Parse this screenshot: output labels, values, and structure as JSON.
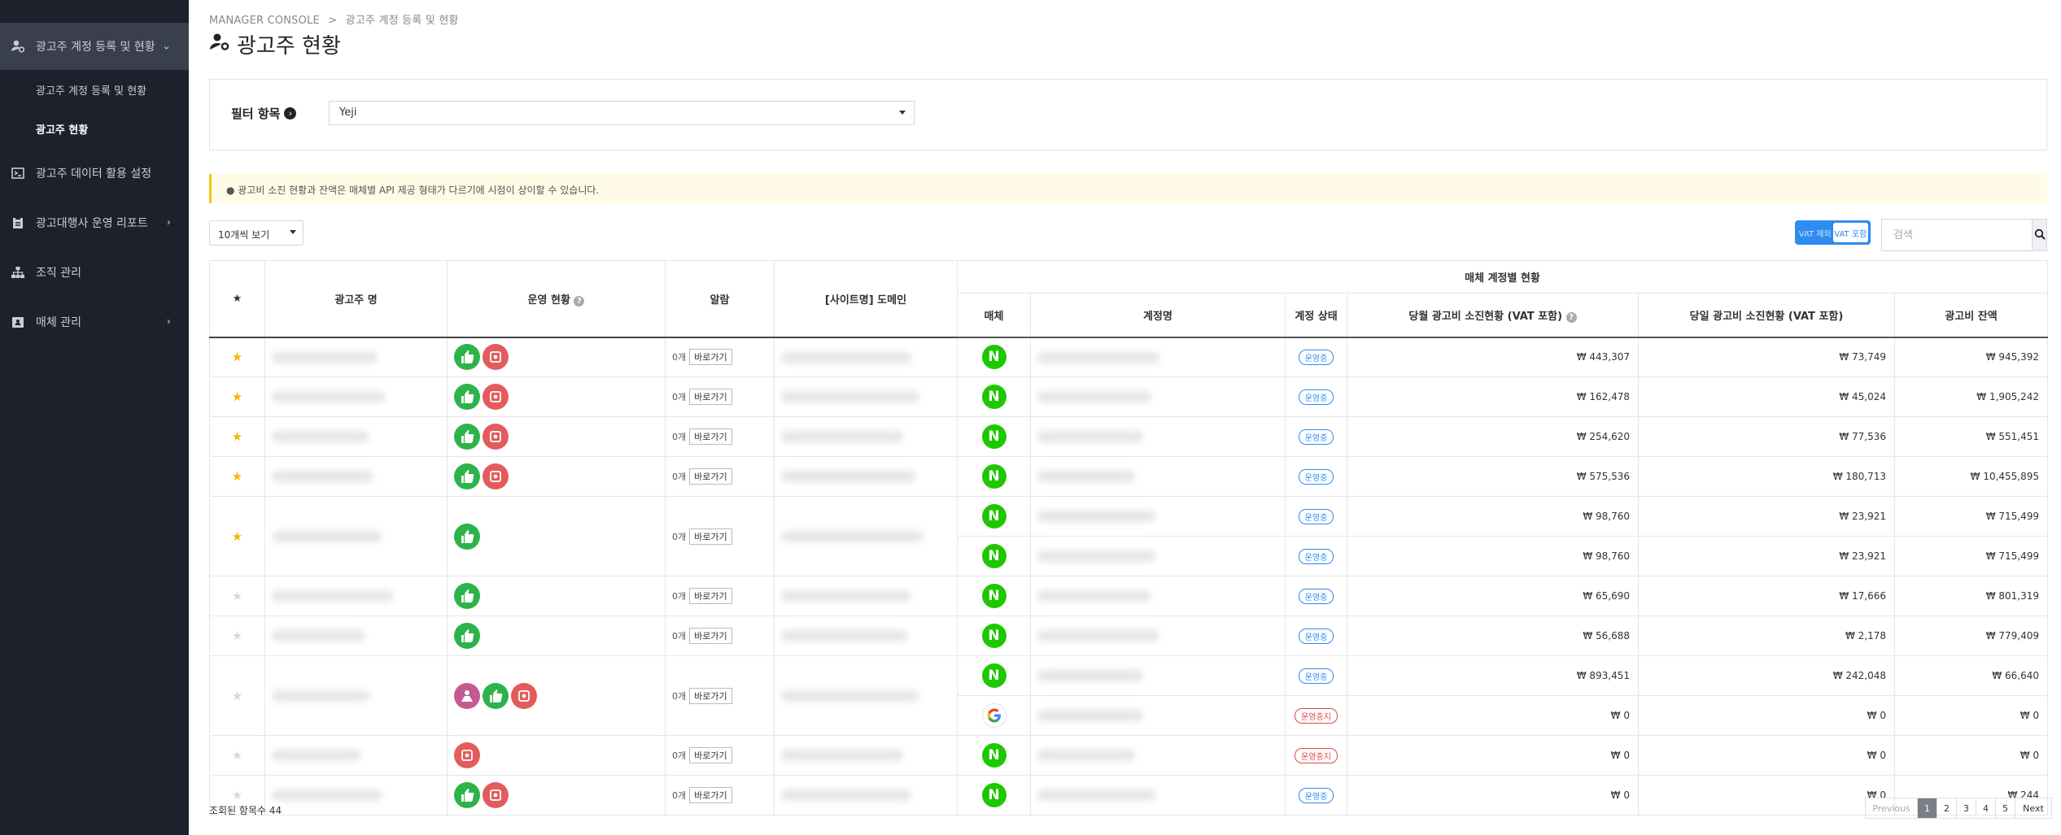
{
  "sidebar": {
    "items": [
      {
        "label": "광고주 계정 등록 및 현황"
      },
      {
        "label": "광고주 데이터 활용 설정"
      },
      {
        "label": "광고대행사 운영 리포트"
      },
      {
        "label": "조직 관리"
      },
      {
        "label": "매체 관리"
      }
    ],
    "subitems": [
      {
        "label": "광고주 계정 등록 및 현황"
      },
      {
        "label": "광고주 현황"
      }
    ]
  },
  "header": {
    "breadcrumb_root": "MANAGER CONSOLE",
    "breadcrumb_sep": ">",
    "breadcrumb_page": "광고주 계정 등록 및 현황",
    "title": "광고주 현황"
  },
  "filter": {
    "label": "필터 항목",
    "selected": "Yeji"
  },
  "notice": "● 광고비 소진 현황과 잔액은 매체별 API 제공 형태가 다르기에 시점이 상이할 수 있습니다.",
  "controls": {
    "per_page": "10개씩 보기",
    "vat_off": "VAT 제외",
    "vat_on": "VAT 포함",
    "search_placeholder": "검색"
  },
  "table": {
    "headers": {
      "star": "★",
      "advertiser": "광고주 명",
      "ops": "운영 현황",
      "alarm": "알람",
      "domain": "[사이트명] 도메인",
      "group": "매체 계정별 현황",
      "media": "매체",
      "account": "계정명",
      "status": "계정 상태",
      "month_spend": "당월 광고비 소진현황 (VAT 포함)",
      "day_spend": "당일 광고비 소진현황 (VAT 포함)",
      "balance": "광고비 잔액"
    },
    "alarm_count": "0개",
    "go_label": "바로가기",
    "status_on": "운영중",
    "status_off": "운영중지",
    "rows": [
      {
        "star": true,
        "ops": [
          "green",
          "red"
        ],
        "accounts": [
          {
            "media": "naver",
            "status": "on",
            "month": "₩ 443,307",
            "day": "₩ 73,749",
            "balance": "₩ 945,392"
          }
        ]
      },
      {
        "star": true,
        "ops": [
          "green",
          "red"
        ],
        "accounts": [
          {
            "media": "naver",
            "status": "on",
            "month": "₩ 162,478",
            "day": "₩ 45,024",
            "balance": "₩ 1,905,242"
          }
        ]
      },
      {
        "star": true,
        "ops": [
          "green",
          "red"
        ],
        "accounts": [
          {
            "media": "naver",
            "status": "on",
            "month": "₩ 254,620",
            "day": "₩ 77,536",
            "balance": "₩ 551,451"
          }
        ]
      },
      {
        "star": true,
        "ops": [
          "green",
          "red"
        ],
        "accounts": [
          {
            "media": "naver",
            "status": "on",
            "month": "₩ 575,536",
            "day": "₩ 180,713",
            "balance": "₩ 10,455,895"
          }
        ]
      },
      {
        "star": true,
        "ops": [
          "green"
        ],
        "accounts": [
          {
            "media": "naver",
            "status": "on",
            "month": "₩ 98,760",
            "day": "₩ 23,921",
            "balance": "₩ 715,499"
          },
          {
            "media": "naver",
            "status": "on",
            "month": "₩ 98,760",
            "day": "₩ 23,921",
            "balance": "₩ 715,499"
          }
        ]
      },
      {
        "star": false,
        "ops": [
          "green"
        ],
        "accounts": [
          {
            "media": "naver",
            "status": "on",
            "month": "₩ 65,690",
            "day": "₩ 17,666",
            "balance": "₩ 801,319"
          }
        ]
      },
      {
        "star": false,
        "ops": [
          "green"
        ],
        "accounts": [
          {
            "media": "naver",
            "status": "on",
            "month": "₩ 56,688",
            "day": "₩ 2,178",
            "balance": "₩ 779,409"
          }
        ]
      },
      {
        "star": false,
        "ops": [
          "pink",
          "green",
          "red"
        ],
        "accounts": [
          {
            "media": "naver",
            "status": "on",
            "month": "₩ 893,451",
            "day": "₩ 242,048",
            "balance": "₩ 66,640"
          },
          {
            "media": "google",
            "status": "off",
            "month": "₩ 0",
            "day": "₩ 0",
            "balance": "₩ 0"
          }
        ]
      },
      {
        "star": false,
        "ops": [
          "red"
        ],
        "accounts": [
          {
            "media": "naver",
            "status": "off",
            "month": "₩ 0",
            "day": "₩ 0",
            "balance": "₩ 0"
          }
        ]
      },
      {
        "star": false,
        "ops": [
          "green",
          "red"
        ],
        "accounts": [
          {
            "media": "naver",
            "status": "on",
            "month": "₩ 0",
            "day": "₩ 0",
            "balance": "₩ 244"
          }
        ]
      }
    ]
  },
  "footer": {
    "count": "조회된 항목수 44",
    "prev": "Previous",
    "pages": [
      "1",
      "2",
      "3",
      "4",
      "5"
    ],
    "next": "Next"
  },
  "colors": {
    "sidebar_bg": "#1d212c",
    "accent": "#2d8cf0",
    "naver_green": "#1ec800",
    "ops_green": "#2cb34a",
    "ops_red": "#e35b5b",
    "star_on": "#f5b400"
  }
}
